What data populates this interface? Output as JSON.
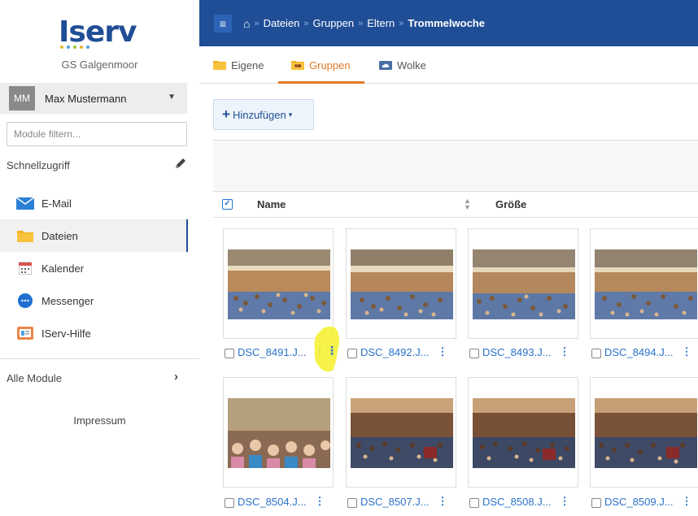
{
  "brand": {
    "logo_text": "Iserv",
    "school": "GS Galgenmoor",
    "colors": {
      "primary": "#1f4e96",
      "accent": "#e07a2a",
      "link": "#2a72c8"
    }
  },
  "user": {
    "initials": "MM",
    "name": "Max Mustermann"
  },
  "sidebar": {
    "filter_placeholder": "Module filtern...",
    "quick_access": "Schnellzugriff",
    "items": [
      {
        "label": "E-Mail",
        "icon": "mail-icon"
      },
      {
        "label": "Dateien",
        "icon": "folder-icon",
        "active": true
      },
      {
        "label": "Kalender",
        "icon": "calendar-icon"
      },
      {
        "label": "Messenger",
        "icon": "chat-icon"
      },
      {
        "label": "IServ-Hilfe",
        "icon": "help-icon"
      }
    ],
    "all_modules": "Alle Module",
    "impressum": "Impressum"
  },
  "breadcrumb": [
    "Dateien",
    "Gruppen",
    "Eltern",
    "Trommelwoche"
  ],
  "tabs": [
    {
      "label": "Eigene",
      "icon": "folder-icon"
    },
    {
      "label": "Gruppen",
      "icon": "group-folder-icon",
      "active": true
    },
    {
      "label": "Wolke",
      "icon": "cloud-icon"
    }
  ],
  "toolbar": {
    "add_label": "Hinzufügen"
  },
  "table": {
    "col_name": "Name",
    "col_size": "Größe"
  },
  "files": [
    {
      "name": "DSC_8491.J..."
    },
    {
      "name": "DSC_8492.J..."
    },
    {
      "name": "DSC_8493.J..."
    },
    {
      "name": "DSC_8494.J..."
    },
    {
      "name": "DSC_8504.J..."
    },
    {
      "name": "DSC_8507.J..."
    },
    {
      "name": "DSC_8508.J..."
    },
    {
      "name": "DSC_8509.J..."
    }
  ]
}
